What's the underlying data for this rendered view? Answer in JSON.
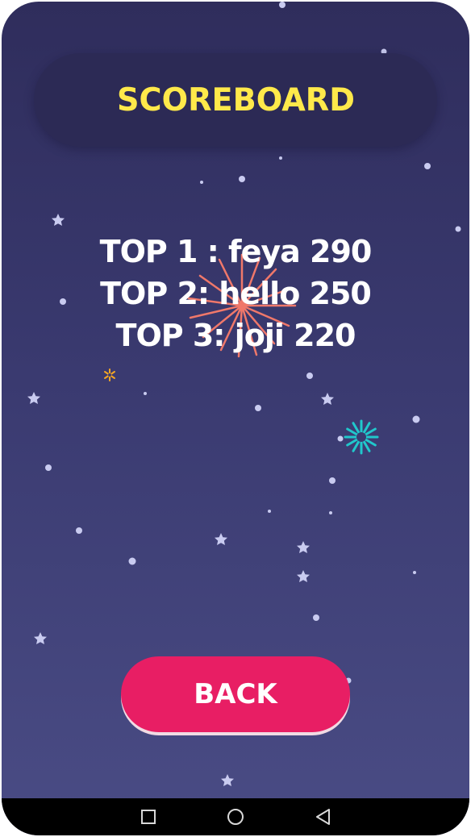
{
  "header": {
    "title": "SCOREBOARD"
  },
  "scores": [
    {
      "text": "TOP 1 : feya 290"
    },
    {
      "text": "TOP 2: hello 250"
    },
    {
      "text": "TOP 3: joji 220"
    }
  ],
  "actions": {
    "back_label": "BACK"
  },
  "colors": {
    "title": "#ffe94a",
    "back_button": "#e81e64",
    "background_top": "#2f2d5c",
    "background_bottom": "#4a4c85",
    "firework_red": "#f0786a",
    "firework_cyan": "#20c8cc"
  },
  "navigation": {
    "icons": [
      "back-triangle-icon",
      "home-circle-icon",
      "recent-apps-square-icon"
    ]
  }
}
